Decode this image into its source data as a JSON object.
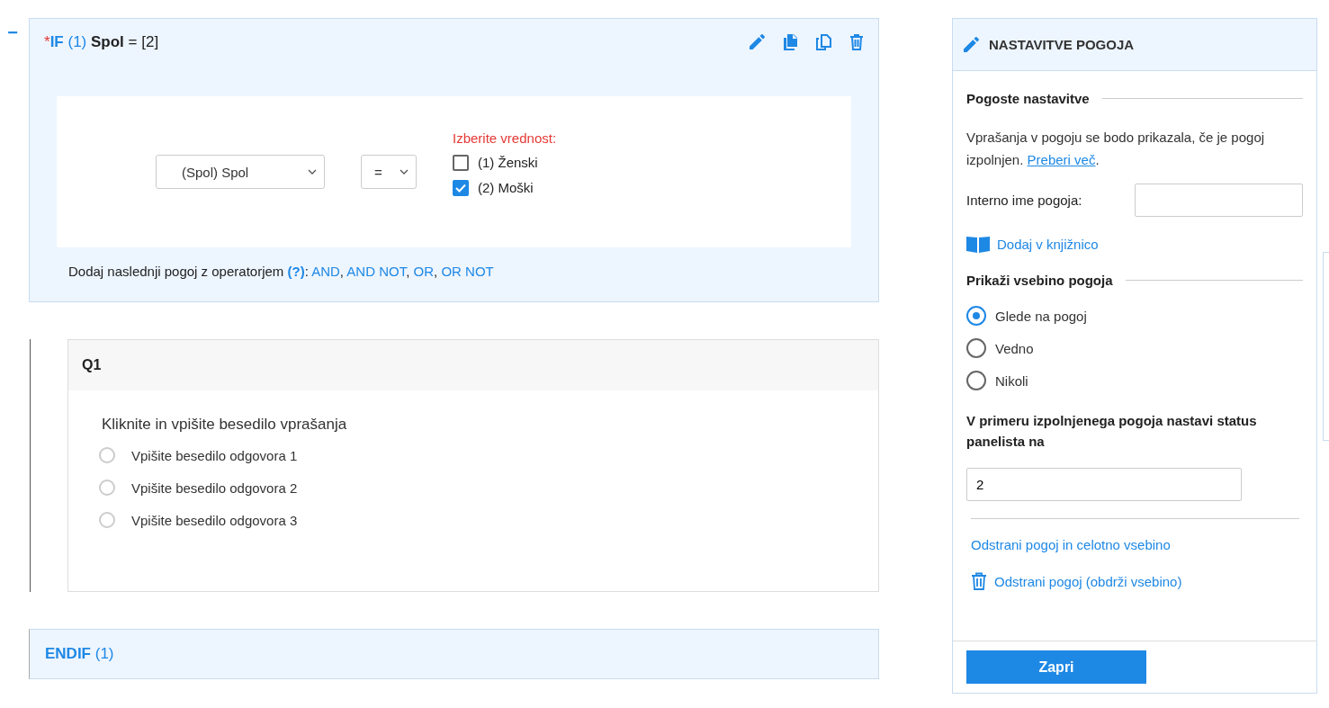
{
  "if_block": {
    "collapse": "−",
    "title": {
      "marker": "*",
      "keyword": "IF",
      "number": "(1)",
      "variable": "Spol",
      "rest": "= [2]"
    },
    "variable_select": {
      "value": "(Spol) Spol"
    },
    "operator_select": {
      "value": "="
    },
    "values_label": "Izberite vrednost:",
    "values": [
      {
        "label": "(1) Ženski",
        "checked": false
      },
      {
        "label": "(2) Moški",
        "checked": true
      }
    ],
    "operator_line": {
      "text": "Dodaj naslednji pogoj z operatorjem",
      "help": "(?)",
      "help_suffix": ":",
      "separator": ",",
      "operators": [
        "AND",
        "AND NOT",
        "OR",
        "OR NOT"
      ]
    }
  },
  "question": {
    "label": "Q1",
    "text": "Kliknite in vpišite besedilo vprašanja",
    "answers": [
      {
        "text": "Vpišite besedilo odgovora 1",
        "selected": false
      },
      {
        "text": "Vpišite besedilo odgovora 2",
        "selected": false
      },
      {
        "text": "Vpišite besedilo odgovora 3",
        "selected": false
      }
    ]
  },
  "endif": {
    "keyword": "ENDIF",
    "number": "(1)"
  },
  "panel": {
    "title": "NASTAVITVE POGOJA",
    "common_heading": "Pogoste nastavitve",
    "description": "Vprašanja v pogoju se bodo prikazala, če je pogoj izpolnjen.",
    "read_more": "Preberi več",
    "read_more_suffix": ".",
    "internal_name_label": "Interno ime pogoja:",
    "library_link": "Dodaj v knjižnico",
    "display_heading": "Prikaži vsebino pogoja",
    "display_options": [
      {
        "label": "Glede na pogoj",
        "selected": true
      },
      {
        "label": "Vedno",
        "selected": false
      },
      {
        "label": "Nikoli",
        "selected": false
      }
    ],
    "status_label": "V primeru izpolnjenega pogoja nastavi status panelista na",
    "status_value": "2",
    "remove_all": "Odstrani pogoj in celotno vsebino",
    "remove_keep": "Odstrani pogoj (obdrži vsebino)",
    "close_button": "Zapri"
  }
}
